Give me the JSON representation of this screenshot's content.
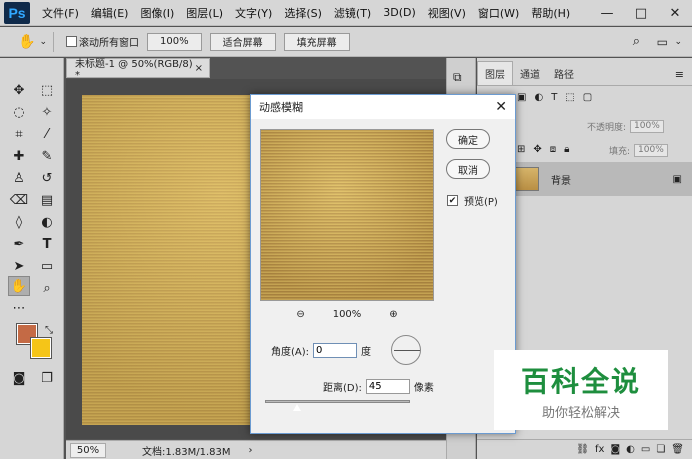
{
  "app": {
    "logo": "Ps"
  },
  "menu": [
    "文件(F)",
    "编辑(E)",
    "图像(I)",
    "图层(L)",
    "文字(Y)",
    "选择(S)",
    "滤镜(T)",
    "3D(D)",
    "视图(V)",
    "窗口(W)",
    "帮助(H)"
  ],
  "window_controls": {
    "minimize": "—",
    "maximize": "□",
    "close": "✕"
  },
  "options": {
    "tool_icon": "hand-icon",
    "scroll_all_label": "滚动所有窗口",
    "zoom_100": "100%",
    "fit_screen": "适合屏幕",
    "fill_screen": "填充屏幕"
  },
  "document": {
    "tab_title": "未标题-1 @ 50%(RGB/8) *",
    "tab_close": "×"
  },
  "status": {
    "zoom": "50%",
    "doc_info": "文档:1.83M/1.83M",
    "arrow": "›"
  },
  "layers": {
    "tabs": [
      "图层",
      "通道",
      "路径"
    ],
    "active_tab": 0,
    "opacity_label": "不透明度:",
    "opacity_value": "100%",
    "fill_label": "填充:",
    "fill_value": "100%",
    "layer_name": "背景"
  },
  "dialog": {
    "title": "动感模糊",
    "close": "✕",
    "ok": "确定",
    "cancel": "取消",
    "preview_label": "预览(P)",
    "preview_checked": true,
    "preview_zoom": "100%",
    "angle_label": "角度(A):",
    "angle_value": "0",
    "angle_unit": "度",
    "distance_label": "距离(D):",
    "distance_value": "45",
    "distance_unit": "像素",
    "slider_fraction": 0.22
  },
  "watermark": {
    "title": "百科全说",
    "subtitle": "助你轻松解决"
  },
  "colors": {
    "foreground": "#c46a45",
    "background": "#f5c518",
    "accent": "#6b9bd1",
    "watermark_green": "#1e8e3e"
  }
}
